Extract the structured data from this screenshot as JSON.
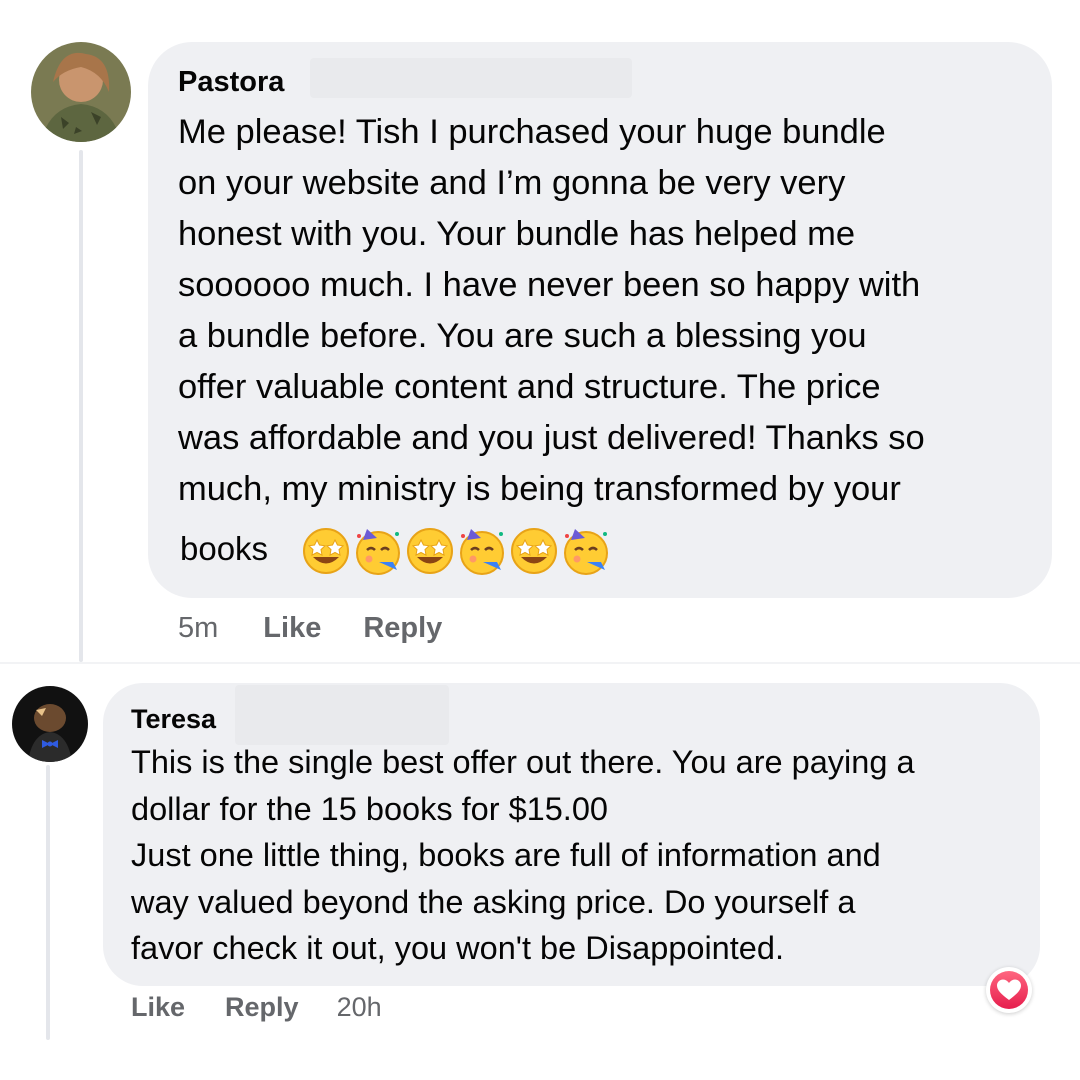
{
  "comments": [
    {
      "author": "Pastora",
      "lines": [
        "Me please!  Tish  I purchased your huge bundle",
        "on your website and I’m gonna be very very",
        "honest with you. Your bundle has helped me",
        "soooooo much. I have never been so happy with",
        "a bundle before. You are such a blessing you",
        "offer valuable content and structure. The price",
        "was affordable and you just delivered! Thanks so",
        "much, my ministry is being transformed by your"
      ],
      "last_word": "books",
      "emojis": [
        "star-struck-emoji",
        "partying-face-emoji",
        "star-struck-emoji",
        "partying-face-emoji",
        "star-struck-emoji",
        "partying-face-emoji"
      ],
      "meta": {
        "time": "5m",
        "like": "Like",
        "reply": "Reply"
      }
    },
    {
      "author": "Teresa",
      "lines": [
        "This is the single best offer out there. You are paying a",
        "dollar for the 15 books for $15.00",
        "Just one little thing,   books  are full of information and",
        "way valued beyond the asking price. Do yourself a",
        "favor check it out, you won't be Disappointed."
      ],
      "meta": {
        "like": "Like",
        "reply": "Reply",
        "time": "20h"
      },
      "reaction": "love-reaction-icon"
    }
  ],
  "colors": {
    "bubble": "#eff0f3",
    "meta": "#65676b",
    "love": "#f33e58"
  }
}
